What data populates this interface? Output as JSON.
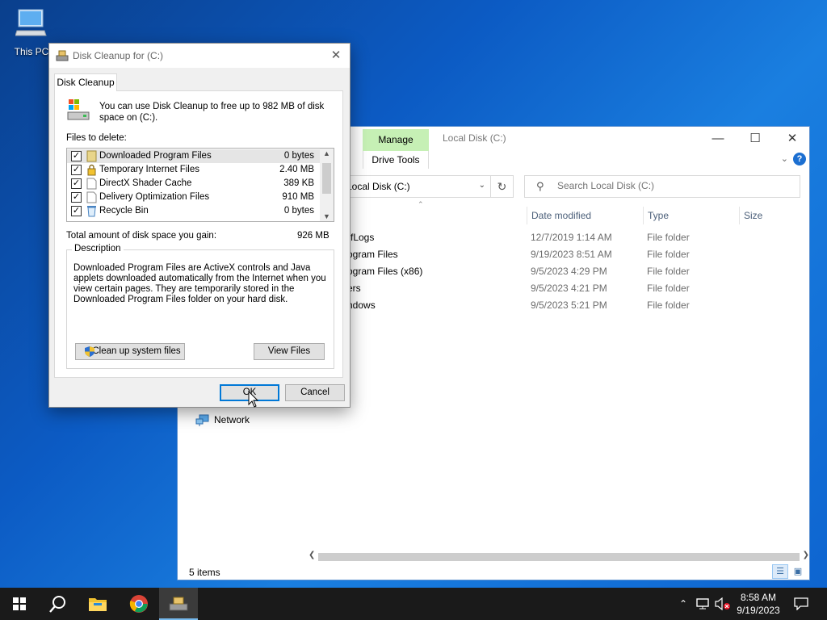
{
  "desktop": {
    "icon_label": "This PC"
  },
  "explorer": {
    "title": "Local Disk (C:)",
    "manage_tab": "Manage",
    "drive_tools": "Drive Tools",
    "address": "Local Disk (C:)",
    "search_placeholder": "Search Local Disk (C:)",
    "columns": {
      "date": "Date modified",
      "type": "Type",
      "size": "Size"
    },
    "rows": [
      {
        "name": "PerfLogs",
        "date": "12/7/2019 1:14 AM",
        "type": "File folder"
      },
      {
        "name": "Program Files",
        "date": "9/19/2023 8:51 AM",
        "type": "File folder"
      },
      {
        "name": "Program Files (x86)",
        "date": "9/5/2023 4:29 PM",
        "type": "File folder"
      },
      {
        "name": "Users",
        "date": "9/5/2023 4:21 PM",
        "type": "File folder"
      },
      {
        "name": "Windows",
        "date": "9/5/2023 5:21 PM",
        "type": "File folder"
      }
    ],
    "rows_visible_names": [
      "rfLogs",
      "ogram Files",
      "ogram Files (x86)",
      "ers",
      "ndows"
    ],
    "nav_network": "Network",
    "status_items": "5 items"
  },
  "dialog": {
    "title": "Disk Cleanup for  (C:)",
    "tab": "Disk Cleanup",
    "info": "You can use Disk Cleanup to free up to 982 MB of disk space on  (C:).",
    "files_label": "Files to delete:",
    "files": [
      {
        "name": "Downloaded Program Files",
        "size": "0 bytes",
        "checked": true
      },
      {
        "name": "Temporary Internet Files",
        "size": "2.40 MB",
        "checked": true
      },
      {
        "name": "DirectX Shader Cache",
        "size": "389 KB",
        "checked": true
      },
      {
        "name": "Delivery Optimization Files",
        "size": "910 MB",
        "checked": true
      },
      {
        "name": "Recycle Bin",
        "size": "0 bytes",
        "checked": true
      }
    ],
    "total_label": "Total amount of disk space you gain:",
    "total_value": "926 MB",
    "description_legend": "Description",
    "description": "Downloaded Program Files are ActiveX controls and Java applets downloaded automatically from the Internet when you view certain pages. They are temporarily stored in the Downloaded Program Files folder on your hard disk.",
    "btn_cleanup_system": "Clean up system files",
    "btn_view_files": "View Files",
    "btn_ok": "OK",
    "btn_cancel": "Cancel"
  },
  "taskbar": {
    "time": "8:58 AM",
    "date": "9/19/2023"
  },
  "colors": {
    "accent": "#0078d7",
    "manage_tab": "#c6f0b5",
    "taskbar": "#1a1a1a"
  }
}
